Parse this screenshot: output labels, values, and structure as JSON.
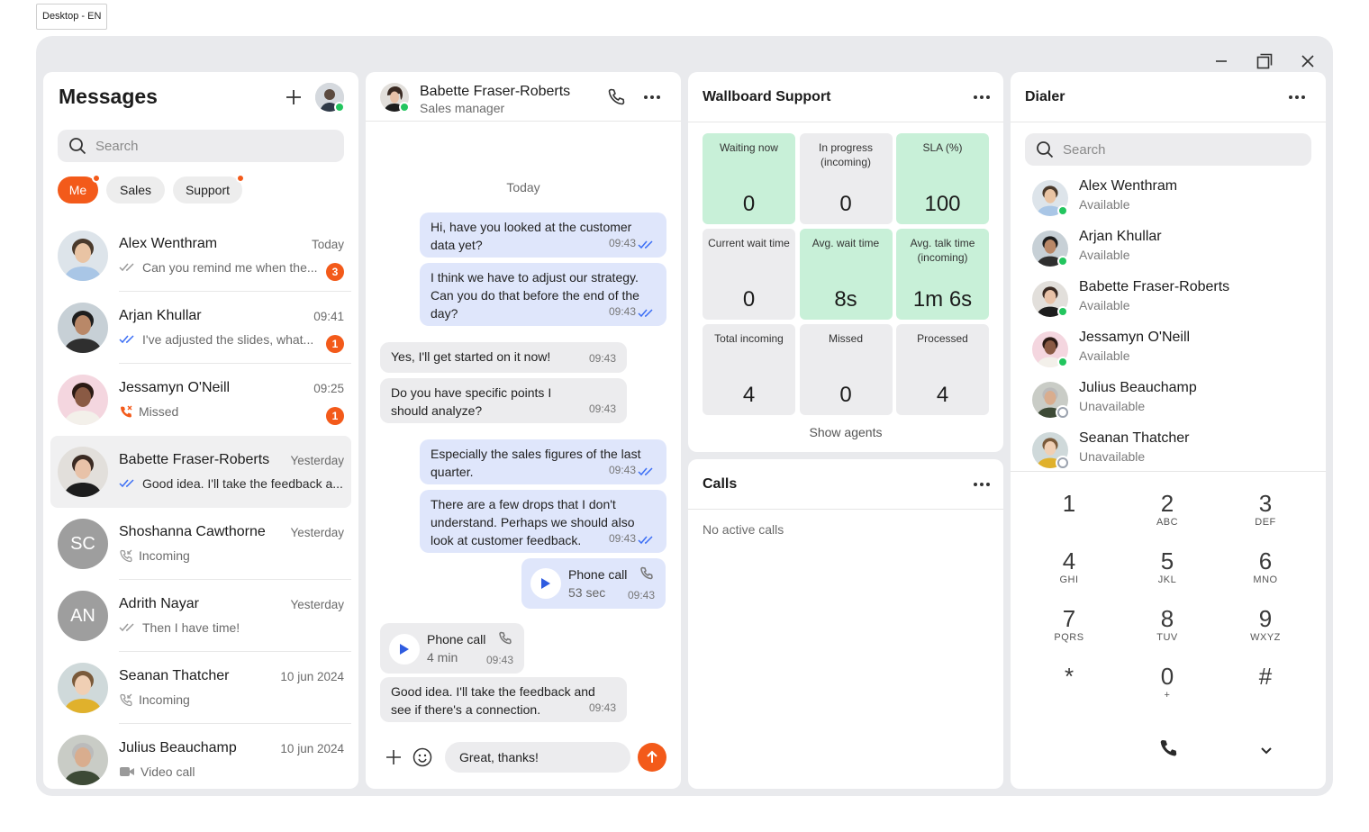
{
  "env_tag": "Desktop - EN",
  "window": {
    "controls": [
      "minimize",
      "maximize",
      "close"
    ]
  },
  "messages": {
    "title": "Messages",
    "search_placeholder": "Search",
    "filters": [
      {
        "label": "Me",
        "active": true,
        "dot": true
      },
      {
        "label": "Sales",
        "active": false,
        "dot": false
      },
      {
        "label": "Support",
        "active": false,
        "dot": true
      }
    ],
    "conversations": [
      {
        "name": "Alex Wenthram",
        "time": "Today",
        "preview": "Can you remind me when the...",
        "icon": "read-ticks-gray",
        "badge": "3"
      },
      {
        "name": "Arjan Khullar",
        "time": "09:41",
        "preview": "I've adjusted the slides, what...",
        "icon": "read-ticks-blue",
        "badge": "1"
      },
      {
        "name": "Jessamyn O'Neill",
        "time": "09:25",
        "preview": "Missed",
        "icon": "missed-call-icon",
        "badge": "1"
      },
      {
        "name": "Babette Fraser-Roberts",
        "time": "Yesterday",
        "preview": "Good idea. I'll take the feedback a...",
        "icon": "read-ticks-blue",
        "badge": ""
      },
      {
        "name": "Shoshanna Cawthorne",
        "time": "Yesterday",
        "preview": "Incoming",
        "icon": "incoming-call-icon",
        "badge": "",
        "initials": "SC"
      },
      {
        "name": "Adrith Nayar",
        "time": "Yesterday",
        "preview": "Then I have time!",
        "icon": "read-ticks-gray",
        "badge": "",
        "initials": "AN"
      },
      {
        "name": "Seanan Thatcher",
        "time": "10 jun 2024",
        "preview": "Incoming",
        "icon": "incoming-call-icon",
        "badge": ""
      },
      {
        "name": "Julius Beauchamp",
        "time": "10 jun 2024",
        "preview": "Video call",
        "icon": "video-call-icon",
        "badge": ""
      }
    ]
  },
  "chat": {
    "contact_name": "Babette Fraser-Roberts",
    "contact_role": "Sales manager",
    "day_separator": "Today",
    "messages": [
      {
        "dir": "out",
        "text": "Hi, have you looked at the customer data yet?",
        "time": "09:43"
      },
      {
        "dir": "out",
        "text": "I think we have to adjust our strategy. Can you do that before the end of the day?",
        "time": "09:43"
      },
      {
        "dir": "in",
        "text": "Yes, I'll get started on it now!",
        "time": "09:43"
      },
      {
        "dir": "in",
        "text": "Do you have specific points I should analyze?",
        "time": "09:43"
      },
      {
        "dir": "out",
        "text": "Especially the sales figures of the last quarter.",
        "time": "09:43"
      },
      {
        "dir": "out",
        "text": "There are a few drops that I don't understand. Perhaps we should also look at customer feedback.",
        "time": "09:43"
      },
      {
        "dir": "out",
        "type": "call",
        "title": "Phone call",
        "duration": "53 sec",
        "time": "09:43"
      },
      {
        "dir": "in",
        "type": "call",
        "title": "Phone call",
        "duration": "4 min",
        "time": "09:43"
      },
      {
        "dir": "in",
        "text": "Good idea. I'll take the feedback and see if there's a connection.",
        "time": "09:43"
      }
    ],
    "composer_value": "Great, thanks!"
  },
  "wallboard": {
    "title": "Wallboard Support",
    "tiles": [
      {
        "label": "Waiting now",
        "value": "0",
        "green": true
      },
      {
        "label": "In progress (incoming)",
        "value": "0",
        "green": false
      },
      {
        "label": "SLA (%)",
        "value": "100",
        "green": true
      },
      {
        "label": "Current wait time",
        "value": "0",
        "green": false
      },
      {
        "label": "Avg. wait time",
        "value": "8s",
        "green": true
      },
      {
        "label": "Avg. talk time (incoming)",
        "value": "1m 6s",
        "green": true
      },
      {
        "label": "Total incoming",
        "value": "4",
        "green": false
      },
      {
        "label": "Missed",
        "value": "0",
        "green": false
      },
      {
        "label": "Processed",
        "value": "4",
        "green": false
      }
    ],
    "show_agents": "Show agents"
  },
  "calls": {
    "title": "Calls",
    "empty_text": "No active calls"
  },
  "dialer": {
    "title": "Dialer",
    "search_placeholder": "Search",
    "contacts": [
      {
        "name": "Alex Wenthram",
        "status": "Available"
      },
      {
        "name": "Arjan Khullar",
        "status": "Available"
      },
      {
        "name": "Babette Fraser-Roberts",
        "status": "Available"
      },
      {
        "name": "Jessamyn O'Neill",
        "status": "Available"
      },
      {
        "name": "Julius Beauchamp",
        "status": "Unavailable"
      },
      {
        "name": "Seanan Thatcher",
        "status": "Unavailable"
      }
    ],
    "keys": [
      {
        "d": "1",
        "l": ""
      },
      {
        "d": "2",
        "l": "ABC"
      },
      {
        "d": "3",
        "l": "DEF"
      },
      {
        "d": "4",
        "l": "GHI"
      },
      {
        "d": "5",
        "l": "JKL"
      },
      {
        "d": "6",
        "l": "MNO"
      },
      {
        "d": "7",
        "l": "PQRS"
      },
      {
        "d": "8",
        "l": "TUV"
      },
      {
        "d": "9",
        "l": "WXYZ"
      },
      {
        "d": "*",
        "l": ""
      },
      {
        "d": "0",
        "l": "+"
      },
      {
        "d": "#",
        "l": ""
      }
    ]
  },
  "colors": {
    "accent": "#f35a1a",
    "online": "#22c55e",
    "tile_green": "#c8f0d8",
    "bubble_out": "#dfe6fb",
    "tick_blue": "#3b6ef5"
  }
}
